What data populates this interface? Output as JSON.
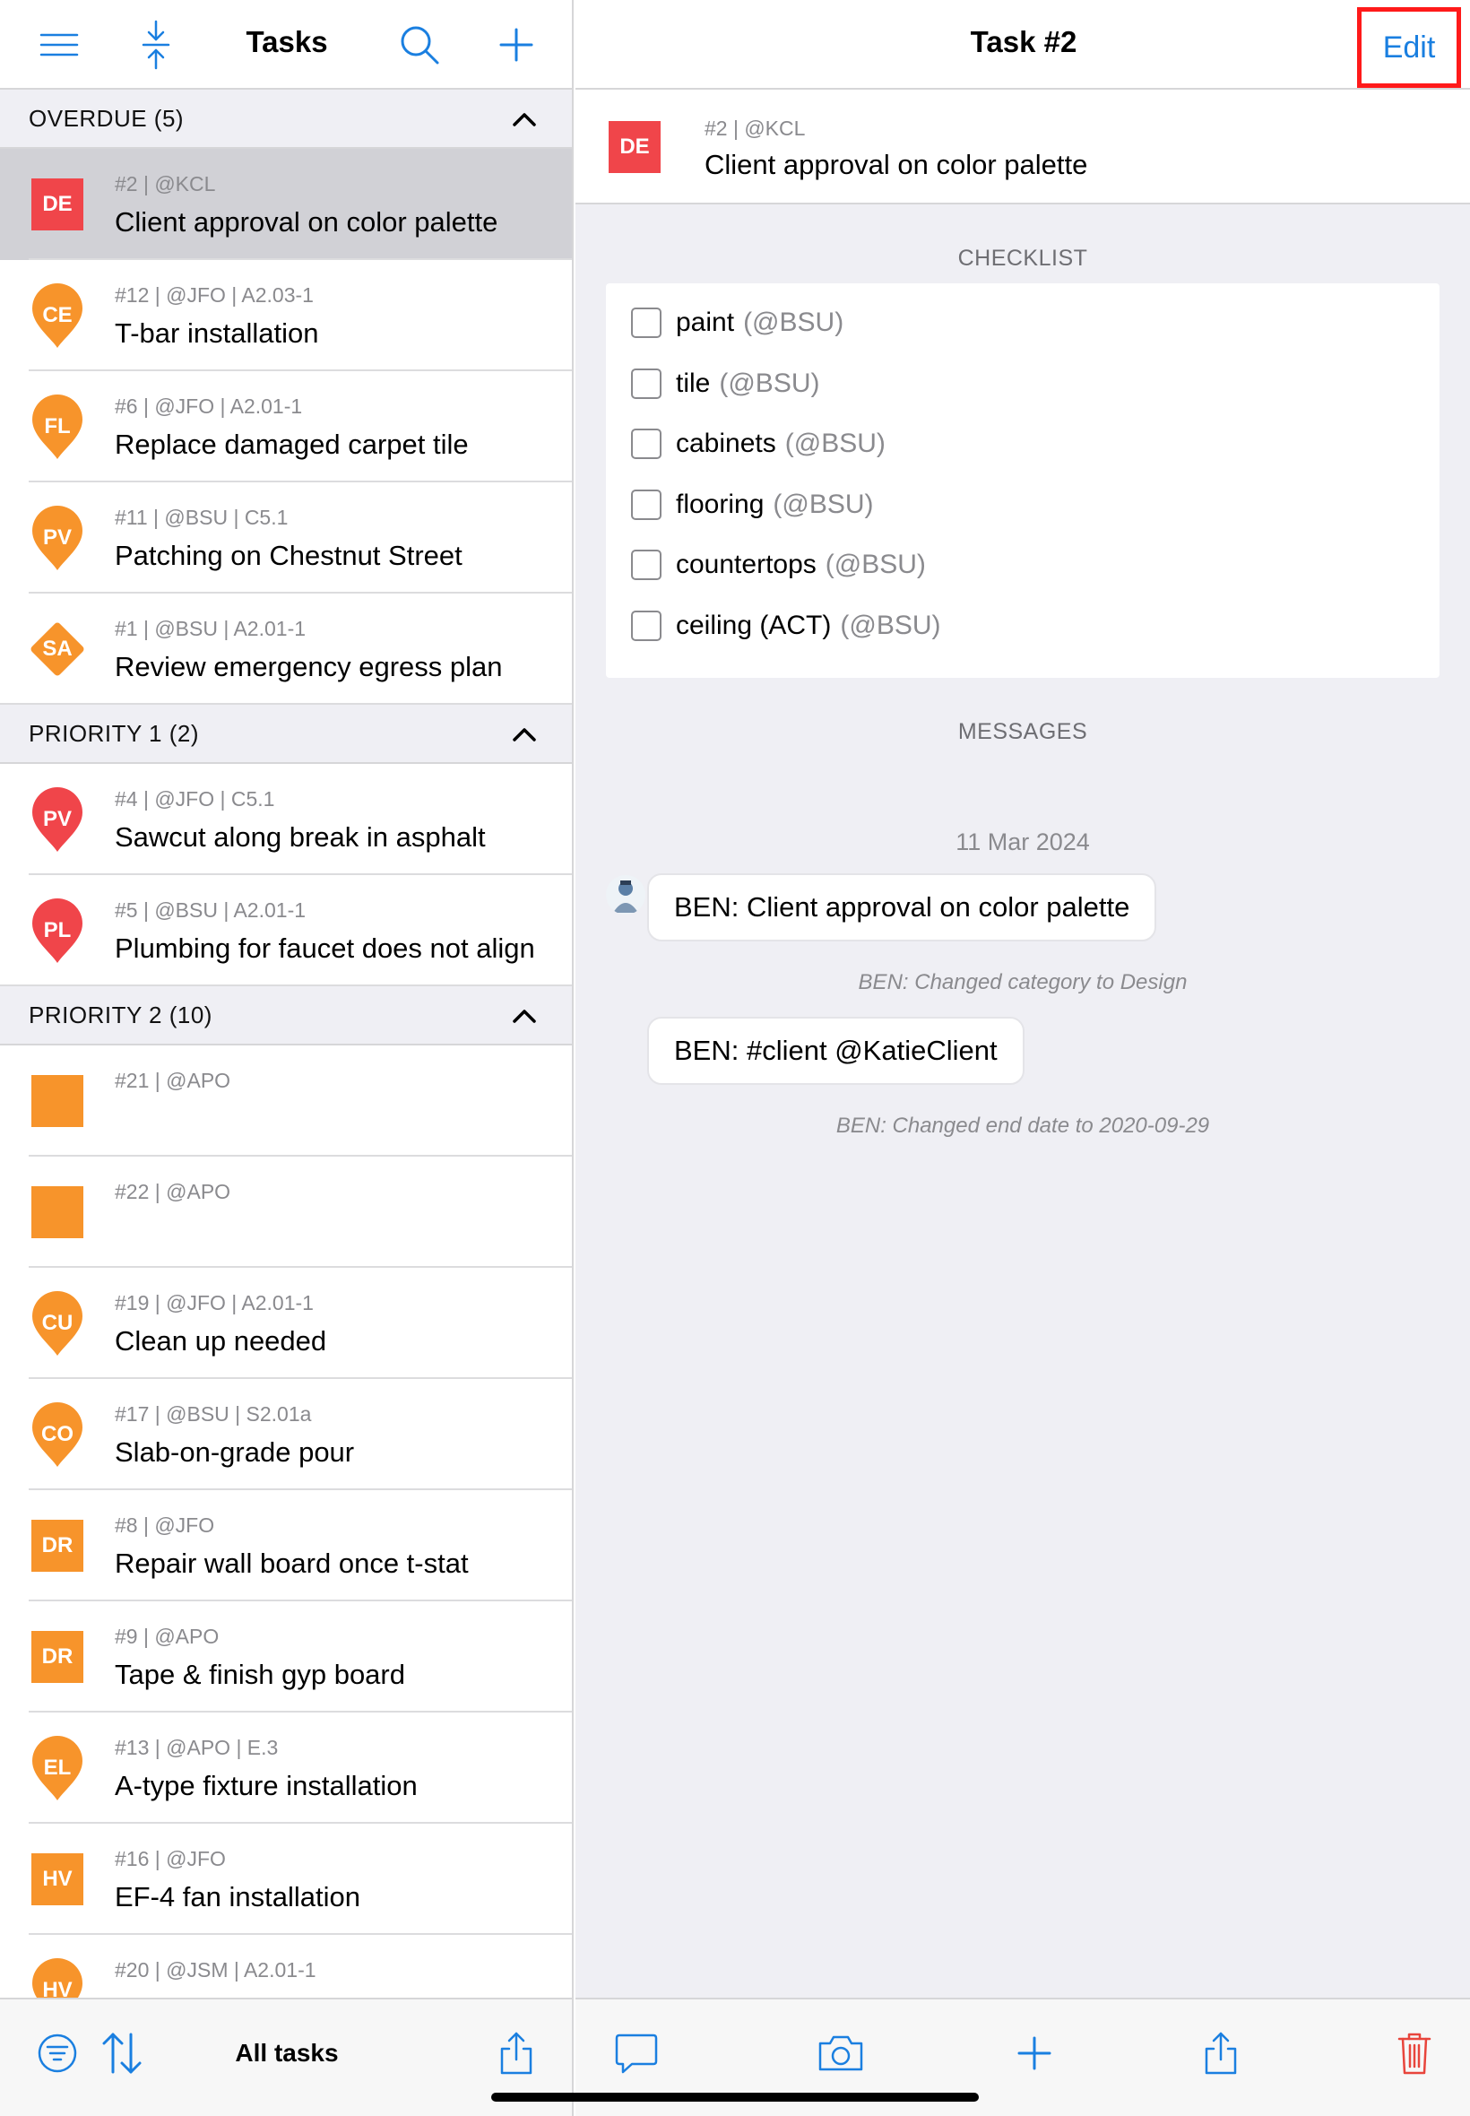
{
  "left_header": {
    "title": "Tasks",
    "icons": [
      "menu-icon",
      "collapse-icon",
      "search-icon",
      "plus-icon"
    ]
  },
  "sections": [
    {
      "label": "OVERDUE (5)",
      "tasks": [
        {
          "badge": "DE",
          "shape": "square",
          "color": "#f0454a",
          "meta": "#2 | @KCL",
          "title": "Client approval on color palette",
          "selected": true
        },
        {
          "badge": "CE",
          "shape": "pin",
          "color": "#f7942b",
          "meta": "#12 | @JFO | A2.03-1",
          "title": "T-bar installation"
        },
        {
          "badge": "FL",
          "shape": "pin",
          "color": "#f7942b",
          "meta": "#6 | @JFO | A2.01-1",
          "title": "Replace damaged carpet tile"
        },
        {
          "badge": "PV",
          "shape": "pin",
          "color": "#f7942b",
          "meta": "#11 | @BSU | C5.1",
          "title": "Patching on Chestnut Street"
        },
        {
          "badge": "SA",
          "shape": "diamond",
          "color": "#f7942b",
          "meta": "#1 | @BSU | A2.01-1",
          "title": "Review emergency egress plan"
        }
      ]
    },
    {
      "label": "PRIORITY 1 (2)",
      "tasks": [
        {
          "badge": "PV",
          "shape": "pin",
          "color": "#f0454a",
          "meta": "#4 | @JFO | C5.1",
          "title": "Sawcut along break in asphalt"
        },
        {
          "badge": "PL",
          "shape": "pin",
          "color": "#f0454a",
          "meta": "#5 | @BSU | A2.01-1",
          "title": "Plumbing for faucet does not align"
        }
      ]
    },
    {
      "label": "PRIORITY 2 (10)",
      "tasks": [
        {
          "badge": "",
          "shape": "square",
          "color": "#f7942b",
          "meta": "#21 | @APO",
          "title": ""
        },
        {
          "badge": "",
          "shape": "square",
          "color": "#f7942b",
          "meta": "#22 | @APO",
          "title": ""
        },
        {
          "badge": "CU",
          "shape": "pin",
          "color": "#f7942b",
          "meta": "#19 | @JFO | A2.01-1",
          "title": "Clean up needed"
        },
        {
          "badge": "CO",
          "shape": "pin",
          "color": "#f7942b",
          "meta": "#17 | @BSU | S2.01a",
          "title": "Slab-on-grade pour"
        },
        {
          "badge": "DR",
          "shape": "square",
          "color": "#f7942b",
          "meta": "#8 | @JFO",
          "title": "Repair wall board once t-stat"
        },
        {
          "badge": "DR",
          "shape": "square",
          "color": "#f7942b",
          "meta": "#9 | @APO",
          "title": "Tape & finish gyp board"
        },
        {
          "badge": "EL",
          "shape": "pin",
          "color": "#f7942b",
          "meta": "#13 | @APO | E.3",
          "title": "A-type fixture installation"
        },
        {
          "badge": "HV",
          "shape": "square",
          "color": "#f7942b",
          "meta": "#16 | @JFO",
          "title": "EF-4 fan installation"
        },
        {
          "badge": "HV",
          "shape": "pin",
          "color": "#f7942b",
          "meta": "#20 | @JSM | A2.01-1",
          "title": ""
        }
      ]
    }
  ],
  "left_toolbar": {
    "label": "All tasks",
    "icons": [
      "filter-icon",
      "sort-icon",
      "share-icon"
    ]
  },
  "detail": {
    "title": "Task #2",
    "edit_label": "Edit",
    "summary": {
      "badge": "DE",
      "color": "#f0454a",
      "meta": "#2 | @KCL",
      "title": "Client approval on color palette"
    },
    "checklist_label": "CHECKLIST",
    "checklist": [
      {
        "label": "paint",
        "assignee": "(@BSU)"
      },
      {
        "label": "tile",
        "assignee": "(@BSU)"
      },
      {
        "label": "cabinets",
        "assignee": "(@BSU)"
      },
      {
        "label": "flooring",
        "assignee": "(@BSU)"
      },
      {
        "label": "countertops",
        "assignee": "(@BSU)"
      },
      {
        "label": "ceiling (ACT)",
        "assignee": "(@BSU)"
      }
    ],
    "messages_label": "MESSAGES",
    "message_date": "11 Mar 2024",
    "messages": [
      {
        "type": "bubble",
        "text": "BEN: Client approval on color palette"
      },
      {
        "type": "system",
        "text": "BEN: Changed category to Design"
      },
      {
        "type": "bubble",
        "text": "BEN: #client @KatieClient"
      },
      {
        "type": "system",
        "text": "BEN: Changed end date to 2020-09-29"
      }
    ]
  },
  "right_toolbar": {
    "icons": [
      "comment-icon",
      "camera-icon",
      "plus-icon",
      "share-icon",
      "trash-icon"
    ]
  },
  "colors": {
    "accent": "#1a7fe0",
    "red": "#f0454a",
    "orange": "#f7942b",
    "highlight_border": "#ff1a1a",
    "delete": "#e8453c"
  }
}
